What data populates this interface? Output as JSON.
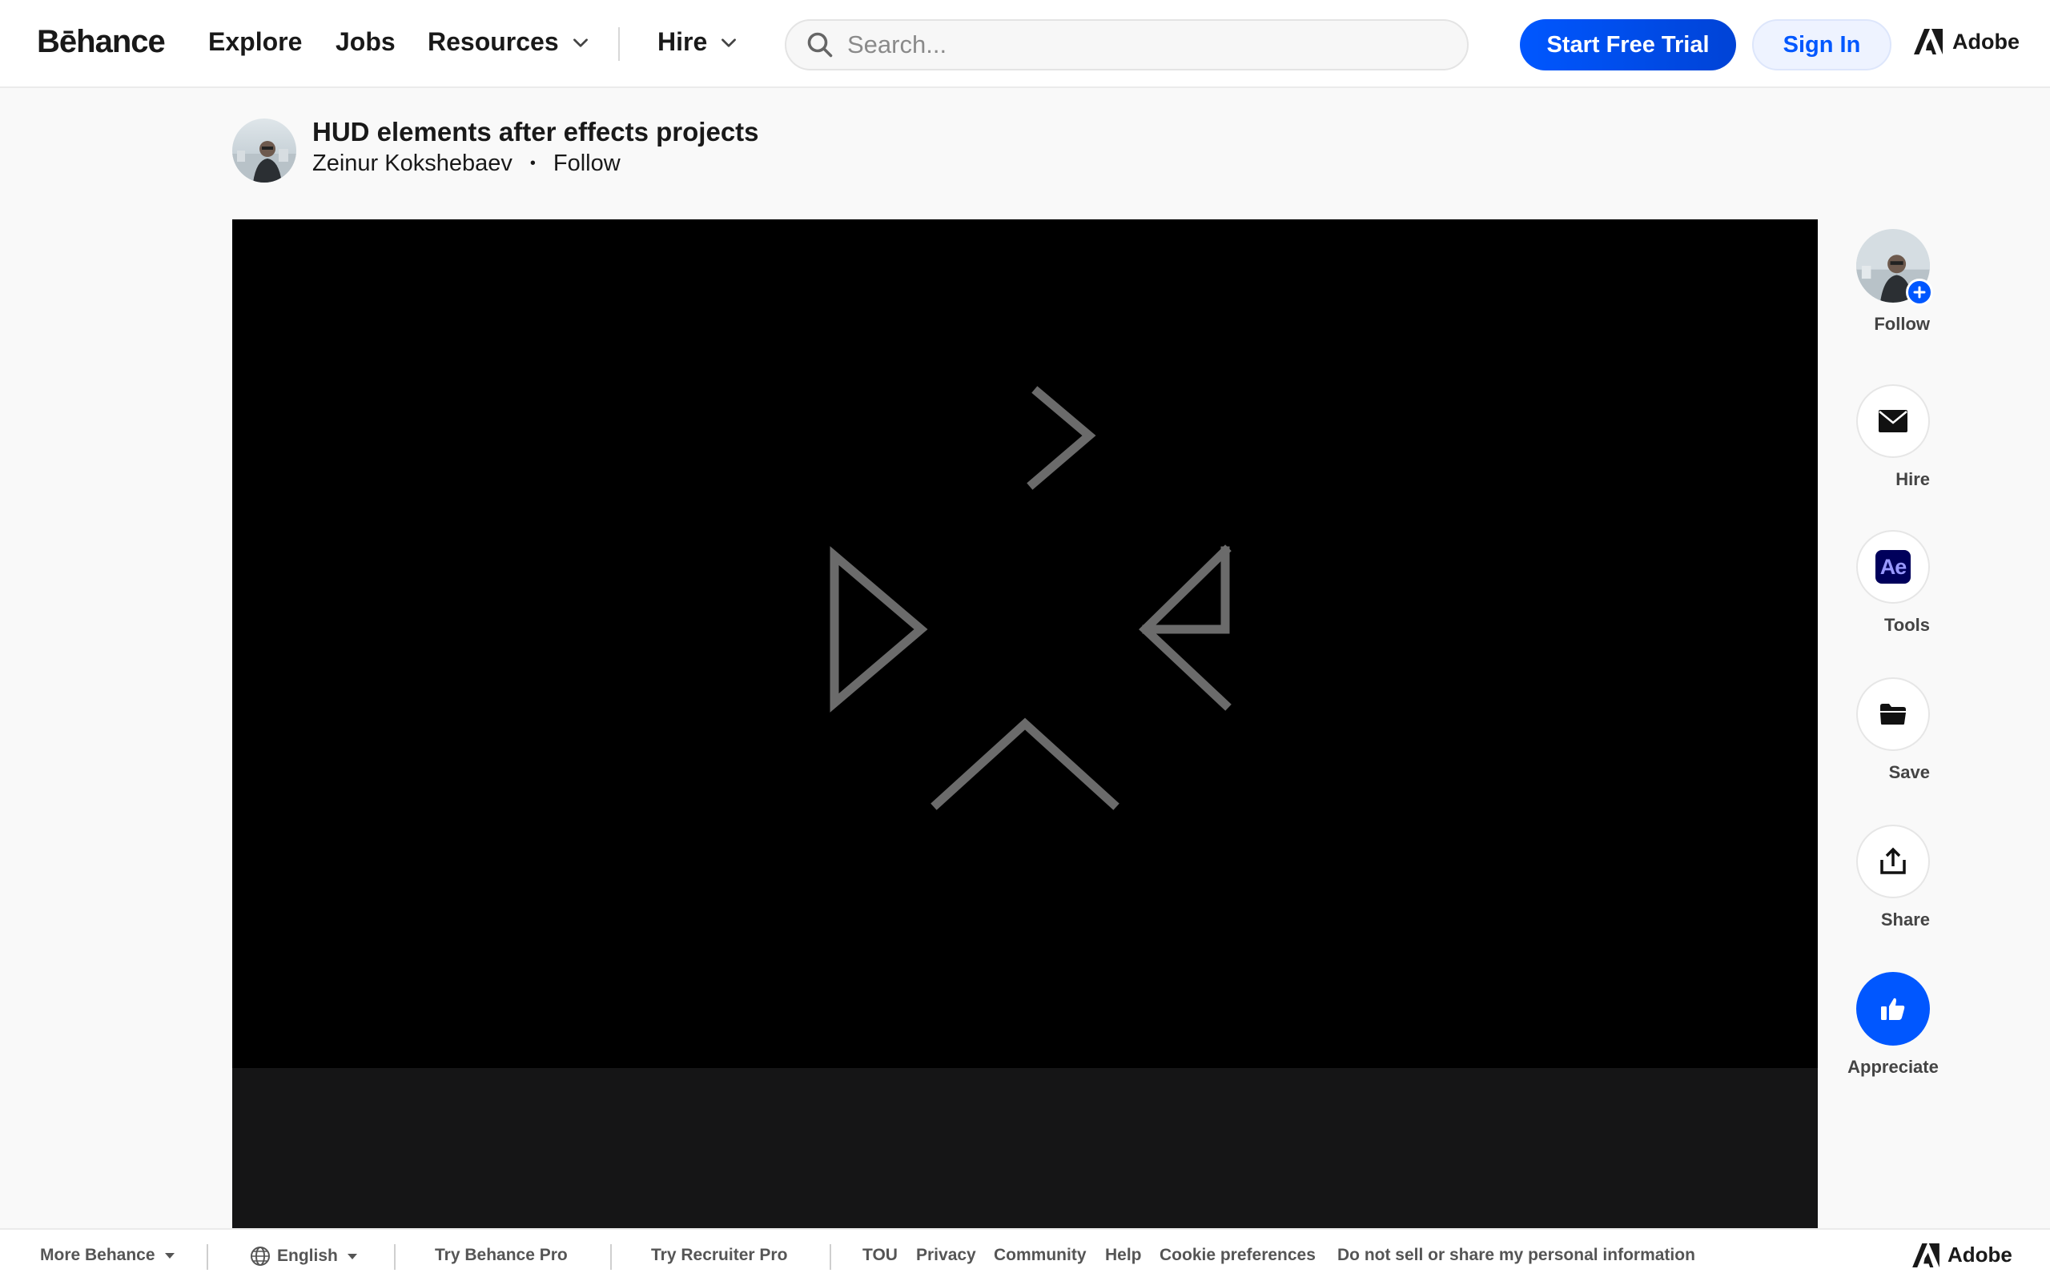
{
  "header": {
    "logo": "Bēhance",
    "nav": [
      "Explore",
      "Jobs",
      "Resources",
      "Hire"
    ],
    "search_placeholder": "Search...",
    "start_trial": "Start Free Trial",
    "sign_in": "Sign In",
    "adobe": "Adobe"
  },
  "project": {
    "title": "HUD elements after effects projects",
    "author": "Zeinur Kokshebaev",
    "separator": "•",
    "follow": "Follow"
  },
  "rail": {
    "follow": "Follow",
    "hire": "Hire",
    "tools": "Tools",
    "tools_badge": "Ae",
    "save": "Save",
    "share": "Share",
    "appreciate": "Appreciate"
  },
  "footer": {
    "more_behance": "More Behance",
    "language": "English",
    "try_pro": "Try Behance Pro",
    "try_recruiter": "Try Recruiter Pro",
    "links": [
      "TOU",
      "Privacy",
      "Community",
      "Help",
      "Cookie preferences",
      "Do not sell or share my personal information"
    ],
    "adobe": "Adobe"
  },
  "colors": {
    "accent": "#0057ff",
    "player_bg": "#000000",
    "hud_stroke": "#6b6b6b"
  }
}
